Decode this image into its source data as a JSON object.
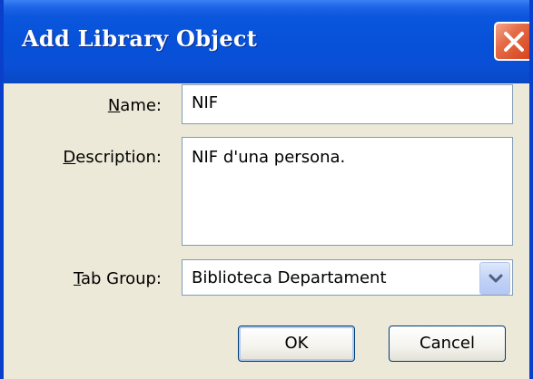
{
  "window": {
    "title": "Add Library Object"
  },
  "form": {
    "name_label_accel": "N",
    "name_label_rest": "ame:",
    "name_value": "NIF",
    "description_label_accel": "D",
    "description_label_rest": "escription:",
    "description_value": "NIF d'una persona.",
    "tabgroup_label_accel": "T",
    "tabgroup_label_rest": "ab Group:",
    "tabgroup_value": "Biblioteca Departament"
  },
  "buttons": {
    "ok_label": "OK",
    "cancel_label": "Cancel"
  },
  "icons": {
    "close": "close-icon",
    "dropdown": "chevron-down-icon"
  },
  "colors": {
    "titlebar": "#0a56dc",
    "close_button": "#e46a45",
    "dialog_background": "#ece9d8",
    "field_border": "#7f9db9"
  }
}
